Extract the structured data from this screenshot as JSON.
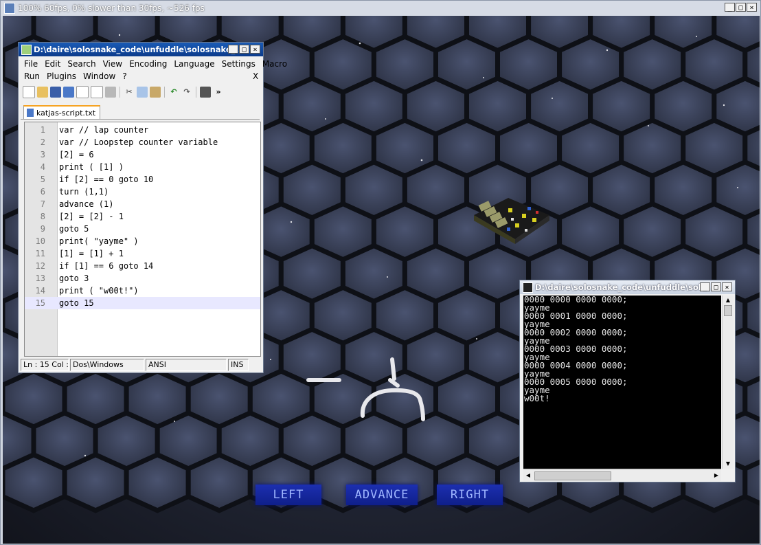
{
  "main_window": {
    "title": "100% 60fps, 0% slower than 30fps, ~526 fps"
  },
  "notepad": {
    "title": "D:\\daire\\solosnake_code\\unfuddle\\solosnake_...",
    "menu_row1": [
      "File",
      "Edit",
      "Search",
      "View",
      "Encoding",
      "Language",
      "Settings",
      "Macro"
    ],
    "menu_row2": [
      "Run",
      "Plugins",
      "Window",
      "?"
    ],
    "menu_close": "X",
    "toolbar_more": "»",
    "tab_label": "katjas-script.txt",
    "lines": [
      {
        "n": "1",
        "code": "var // lap counter"
      },
      {
        "n": "2",
        "code": "var // Loopstep counter variable"
      },
      {
        "n": "3",
        "code": "[2] = 6"
      },
      {
        "n": "4",
        "code": "print ( [1] )"
      },
      {
        "n": "5",
        "code": "if [2] == 0 goto 10"
      },
      {
        "n": "6",
        "code": "turn (1,1)"
      },
      {
        "n": "7",
        "code": "advance (1)"
      },
      {
        "n": "8",
        "code": "[2] = [2] - 1"
      },
      {
        "n": "9",
        "code": "goto 5"
      },
      {
        "n": "10",
        "code": "print( \"yayme\" )"
      },
      {
        "n": "11",
        "code": "[1] = [1] + 1"
      },
      {
        "n": "12",
        "code": "if [1] == 6 goto 14"
      },
      {
        "n": "13",
        "code": "goto 3"
      },
      {
        "n": "14",
        "code": "print ( \"w00t!\")"
      },
      {
        "n": "15",
        "code": "goto 15"
      }
    ],
    "status": {
      "pos": "Ln : 15   Col :",
      "eol": "Dos\\Windows",
      "encoding": "ANSI",
      "mode": "INS"
    }
  },
  "console": {
    "title": "D:\\daire\\solosnake_code\\unfuddle\\sol...",
    "lines": [
      "0000 0000 0000 0000;",
      "yayme",
      "0000 0001 0000 0000;",
      "yayme",
      "0000 0002 0000 0000;",
      "yayme",
      "0000 0003 0000 0000;",
      "yayme",
      "0000 0004 0000 0000;",
      "yayme",
      "0000 0005 0000 0000;",
      "yayme",
      "w00t!"
    ]
  },
  "controls": {
    "left": "LEFT",
    "advance": "ADVANCE",
    "right": "RIGHT"
  }
}
